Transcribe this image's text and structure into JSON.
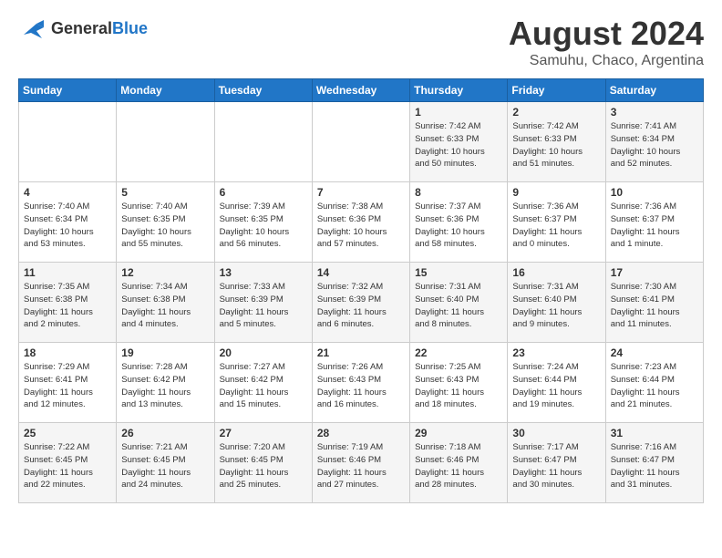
{
  "header": {
    "logo_line1": "General",
    "logo_line2": "Blue",
    "month_year": "August 2024",
    "location": "Samuhu, Chaco, Argentina"
  },
  "weekdays": [
    "Sunday",
    "Monday",
    "Tuesday",
    "Wednesday",
    "Thursday",
    "Friday",
    "Saturday"
  ],
  "weeks": [
    [
      {
        "day": "",
        "info": ""
      },
      {
        "day": "",
        "info": ""
      },
      {
        "day": "",
        "info": ""
      },
      {
        "day": "",
        "info": ""
      },
      {
        "day": "1",
        "info": "Sunrise: 7:42 AM\nSunset: 6:33 PM\nDaylight: 10 hours\nand 50 minutes."
      },
      {
        "day": "2",
        "info": "Sunrise: 7:42 AM\nSunset: 6:33 PM\nDaylight: 10 hours\nand 51 minutes."
      },
      {
        "day": "3",
        "info": "Sunrise: 7:41 AM\nSunset: 6:34 PM\nDaylight: 10 hours\nand 52 minutes."
      }
    ],
    [
      {
        "day": "4",
        "info": "Sunrise: 7:40 AM\nSunset: 6:34 PM\nDaylight: 10 hours\nand 53 minutes."
      },
      {
        "day": "5",
        "info": "Sunrise: 7:40 AM\nSunset: 6:35 PM\nDaylight: 10 hours\nand 55 minutes."
      },
      {
        "day": "6",
        "info": "Sunrise: 7:39 AM\nSunset: 6:35 PM\nDaylight: 10 hours\nand 56 minutes."
      },
      {
        "day": "7",
        "info": "Sunrise: 7:38 AM\nSunset: 6:36 PM\nDaylight: 10 hours\nand 57 minutes."
      },
      {
        "day": "8",
        "info": "Sunrise: 7:37 AM\nSunset: 6:36 PM\nDaylight: 10 hours\nand 58 minutes."
      },
      {
        "day": "9",
        "info": "Sunrise: 7:36 AM\nSunset: 6:37 PM\nDaylight: 11 hours\nand 0 minutes."
      },
      {
        "day": "10",
        "info": "Sunrise: 7:36 AM\nSunset: 6:37 PM\nDaylight: 11 hours\nand 1 minute."
      }
    ],
    [
      {
        "day": "11",
        "info": "Sunrise: 7:35 AM\nSunset: 6:38 PM\nDaylight: 11 hours\nand 2 minutes."
      },
      {
        "day": "12",
        "info": "Sunrise: 7:34 AM\nSunset: 6:38 PM\nDaylight: 11 hours\nand 4 minutes."
      },
      {
        "day": "13",
        "info": "Sunrise: 7:33 AM\nSunset: 6:39 PM\nDaylight: 11 hours\nand 5 minutes."
      },
      {
        "day": "14",
        "info": "Sunrise: 7:32 AM\nSunset: 6:39 PM\nDaylight: 11 hours\nand 6 minutes."
      },
      {
        "day": "15",
        "info": "Sunrise: 7:31 AM\nSunset: 6:40 PM\nDaylight: 11 hours\nand 8 minutes."
      },
      {
        "day": "16",
        "info": "Sunrise: 7:31 AM\nSunset: 6:40 PM\nDaylight: 11 hours\nand 9 minutes."
      },
      {
        "day": "17",
        "info": "Sunrise: 7:30 AM\nSunset: 6:41 PM\nDaylight: 11 hours\nand 11 minutes."
      }
    ],
    [
      {
        "day": "18",
        "info": "Sunrise: 7:29 AM\nSunset: 6:41 PM\nDaylight: 11 hours\nand 12 minutes."
      },
      {
        "day": "19",
        "info": "Sunrise: 7:28 AM\nSunset: 6:42 PM\nDaylight: 11 hours\nand 13 minutes."
      },
      {
        "day": "20",
        "info": "Sunrise: 7:27 AM\nSunset: 6:42 PM\nDaylight: 11 hours\nand 15 minutes."
      },
      {
        "day": "21",
        "info": "Sunrise: 7:26 AM\nSunset: 6:43 PM\nDaylight: 11 hours\nand 16 minutes."
      },
      {
        "day": "22",
        "info": "Sunrise: 7:25 AM\nSunset: 6:43 PM\nDaylight: 11 hours\nand 18 minutes."
      },
      {
        "day": "23",
        "info": "Sunrise: 7:24 AM\nSunset: 6:44 PM\nDaylight: 11 hours\nand 19 minutes."
      },
      {
        "day": "24",
        "info": "Sunrise: 7:23 AM\nSunset: 6:44 PM\nDaylight: 11 hours\nand 21 minutes."
      }
    ],
    [
      {
        "day": "25",
        "info": "Sunrise: 7:22 AM\nSunset: 6:45 PM\nDaylight: 11 hours\nand 22 minutes."
      },
      {
        "day": "26",
        "info": "Sunrise: 7:21 AM\nSunset: 6:45 PM\nDaylight: 11 hours\nand 24 minutes."
      },
      {
        "day": "27",
        "info": "Sunrise: 7:20 AM\nSunset: 6:45 PM\nDaylight: 11 hours\nand 25 minutes."
      },
      {
        "day": "28",
        "info": "Sunrise: 7:19 AM\nSunset: 6:46 PM\nDaylight: 11 hours\nand 27 minutes."
      },
      {
        "day": "29",
        "info": "Sunrise: 7:18 AM\nSunset: 6:46 PM\nDaylight: 11 hours\nand 28 minutes."
      },
      {
        "day": "30",
        "info": "Sunrise: 7:17 AM\nSunset: 6:47 PM\nDaylight: 11 hours\nand 30 minutes."
      },
      {
        "day": "31",
        "info": "Sunrise: 7:16 AM\nSunset: 6:47 PM\nDaylight: 11 hours\nand 31 minutes."
      }
    ]
  ]
}
